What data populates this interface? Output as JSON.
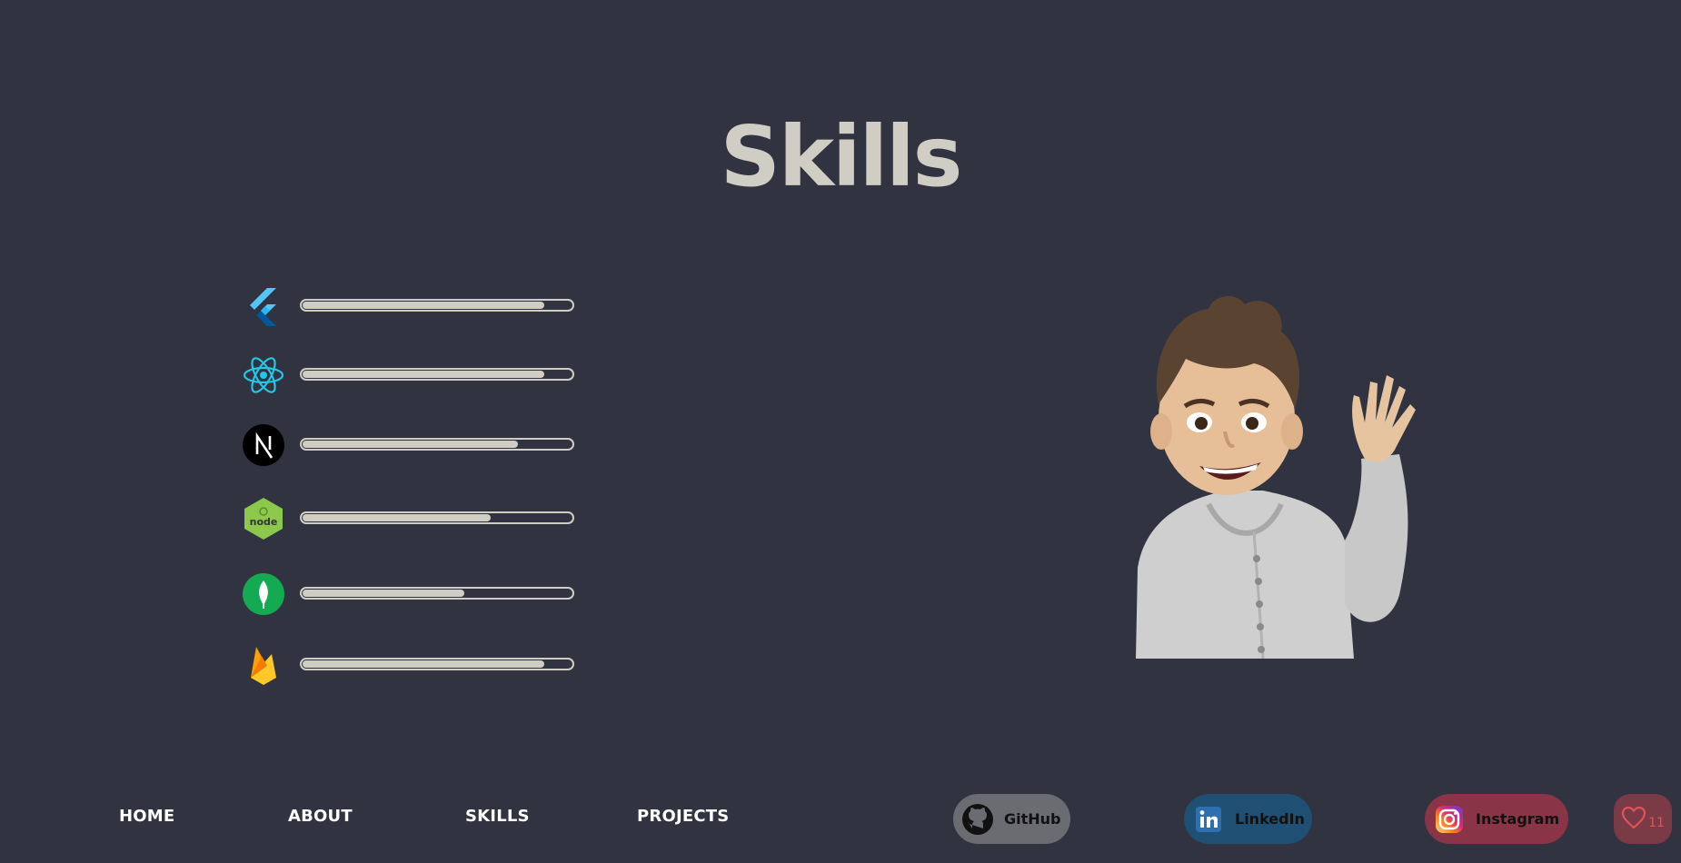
{
  "page": {
    "title": "Skills"
  },
  "skills": [
    {
      "icon": "flutter-icon",
      "level": 0.9
    },
    {
      "icon": "react-icon",
      "level": 0.9
    },
    {
      "icon": "nextjs-icon",
      "level": 0.8
    },
    {
      "icon": "nodejs-icon",
      "level": 0.7
    },
    {
      "icon": "mongodb-icon",
      "level": 0.6
    },
    {
      "icon": "firebase-icon",
      "level": 0.9
    }
  ],
  "nav": {
    "home": "HOME",
    "about": "ABOUT",
    "skills": "SKILLS",
    "projects": "PROJECTS"
  },
  "social": {
    "github": {
      "label": "GitHub",
      "color": "#6b6c72"
    },
    "linkedin": {
      "label": "LinkedIn",
      "color": "#1f4f72"
    },
    "instagram": {
      "label": "Instagram",
      "color": "#8a3448"
    }
  },
  "likes": {
    "count": "11"
  },
  "colors": {
    "background": "#313340",
    "accent": "#d0cec4",
    "like": "#e0525c"
  }
}
